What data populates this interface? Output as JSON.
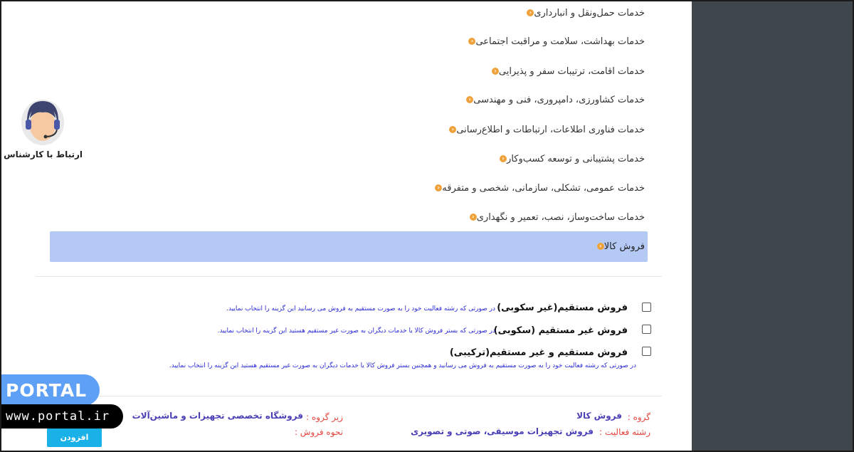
{
  "categories": [
    {
      "label": "خدمات حمل‌ونقل و انبارداری"
    },
    {
      "label": "خدمات بهداشت، سلامت و مراقبت اجتماعی"
    },
    {
      "label": "خدمات اقامت، ترتیبات سفر و پذیرایی"
    },
    {
      "label": "خدمات کشاورزی، دامپروری، فنی و مهندسی"
    },
    {
      "label": "خدمات فناوری اطلاعات، ارتباطات و اطلاع‌رسانی"
    },
    {
      "label": "خدمات پشتیبانی و توسعه کسب‌وکار"
    },
    {
      "label": "خدمات عمومی، تشکلی، سازمانی، شخصی و متفرقه"
    },
    {
      "label": "خدمات ساخت‌وساز، نصب، تعمیر و نگهداری"
    }
  ],
  "selected_category": {
    "label": "فروش کالا"
  },
  "sale_options": [
    {
      "label": "فروش مستقیم(غیر سکوبی)",
      "description": "در صورتی که رشته فعالیت خود را به صورت مستقیم به فروش می رسانید این گزینه را انتخاب نمایید.",
      "checked": false
    },
    {
      "label": "فروش غیر مستقیم (سکوبی)",
      "description": "در صورتی که بستر فروش کالا یا خدمات دیگران به صورت غیر مستقیم هستید این گزینه را انتخاب نمایید.",
      "checked": false
    },
    {
      "label": "فروش مستقیم و غیر مستقیم(ترکیبی)",
      "description": "در صورتی که رشته فعالیت خود را به صورت مستقیم به فروش می رسانید و همچنین بستر فروش کالا یا خدمات دیگران به صورت غیر مستقیم هستید این گزینه را انتخاب نمایید.",
      "checked": false
    }
  ],
  "summary": {
    "group_label": "گروه :",
    "group_value": "فروش کالا",
    "subgroup_label": "زیر گروه :",
    "subgroup_value": "فروشگاه تخصصی تجهیزات و ماشین‌آلات",
    "activity_label": "رشته فعالیت :",
    "activity_value": "فروش تجهیزات موسیقی، صوتی و تصویری",
    "sale_method_label": "نحوه فروش :",
    "sale_method_value": ""
  },
  "add_button": "افزودن",
  "support": {
    "label": "ارتباط با کارشناس",
    "icon": "support-agent-icon"
  },
  "watermark": {
    "brand": "PORTAL",
    "url": "www.portal.ir"
  },
  "colors": {
    "selected_bg": "#b4c9f4",
    "bullet": "#f0a23a",
    "button": "#1ab0e8",
    "summary_label": "#e4463f",
    "summary_value": "#4a3fb4"
  }
}
